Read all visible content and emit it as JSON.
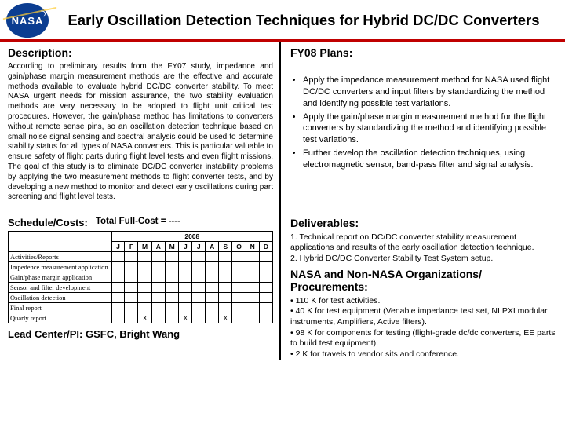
{
  "logo_text": "NASA",
  "title": "Early Oscillation Detection Techniques for Hybrid DC/DC Converters",
  "left": {
    "description_h": "Description:",
    "description": "According to preliminary results from the FY07 study,  impedance and gain/phase margin measurement methods are the effective and accurate methods available to evaluate hybrid DC/DC converter stability. To meet NASA urgent needs for mission assurance, the two stability evaluation methods are very necessary  to be adopted to flight unit critical test procedures. However, the gain/phase method has limitations to converters without remote sense pins, so an oscillation detection technique based on small noise signal sensing and spectral analysis could  be used to determine stability status for all types of NASA converters.  This is particular valuable to ensure safety of flight parts during flight level tests and even flight missions. The goal of this study is to eliminate DC/DC converter instability problems by applying the two measurement methods to flight converter tests, and by developing a new method to monitor and detect early oscillations during part screening and flight level tests.",
    "schedule": {
      "h": "Schedule/Costs:",
      "total": "Total Full-Cost  = ----",
      "year": "2008",
      "months": [
        "J",
        "F",
        "M",
        "A",
        "M",
        "J",
        "J",
        "A",
        "S",
        "O",
        "N",
        "D"
      ],
      "rows": [
        {
          "label": "Activities/Reports",
          "marks": [
            "",
            "",
            "",
            "",
            "",
            "",
            "",
            "",
            "",
            "",
            "",
            ""
          ]
        },
        {
          "label": "Impedence measurement application",
          "marks": [
            "",
            "",
            "",
            "",
            "",
            "",
            "",
            "",
            "",
            "",
            "",
            ""
          ]
        },
        {
          "label": "Gain/phase margin application",
          "marks": [
            "",
            "",
            "",
            "",
            "",
            "",
            "",
            "",
            "",
            "",
            "",
            ""
          ]
        },
        {
          "label": "Sensor and filter development",
          "marks": [
            "",
            "",
            "",
            "",
            "",
            "",
            "",
            "",
            "",
            "",
            "",
            ""
          ]
        },
        {
          "label": "Oscillation detection",
          "marks": [
            "",
            "",
            "",
            "",
            "",
            "",
            "",
            "",
            "",
            "",
            "",
            ""
          ]
        },
        {
          "label": "Final report",
          "marks": [
            "",
            "",
            "",
            "",
            "",
            "",
            "",
            "",
            "",
            "",
            "",
            ""
          ]
        },
        {
          "label": "Quarly report",
          "marks": [
            "",
            "",
            "X",
            "",
            "",
            "X",
            "",
            "",
            "X",
            "",
            "",
            ""
          ]
        }
      ]
    },
    "lead": "Lead Center/PI: GSFC, Bright Wang"
  },
  "right": {
    "plans_h": "FY08 Plans:",
    "plans": [
      "Apply the impedance measurement method for NASA used flight DC/DC converters and input filters by standardizing the method and identifying possible test variations.",
      "Apply the gain/phase margin measurement method for the flight converters by standardizing the method and identifying possible test variations.",
      "Further develop the oscillation detection techniques, using electromagnetic sensor, band-pass filter and signal analysis."
    ],
    "deliv_h": "Deliverables:",
    "deliv": [
      "1. Technical report on DC/DC converter stability measurement applications and results of the early oscillation detection technique.",
      "2. Hybrid DC/DC Converter Stability Test System setup."
    ],
    "proc_h": "NASA and Non-NASA Organizations/ Procurements:",
    "proc": [
      "• 110 K for test activities.",
      "• 40 K for test equipment (Venable impedance test set, NI PXI modular instruments, Amplifiers, Active filters).",
      "• 98 K for components for testing (flight-grade dc/dc converters, EE parts to build test equipment).",
      "• 2 K for travels to vendor sits and conference."
    ]
  }
}
